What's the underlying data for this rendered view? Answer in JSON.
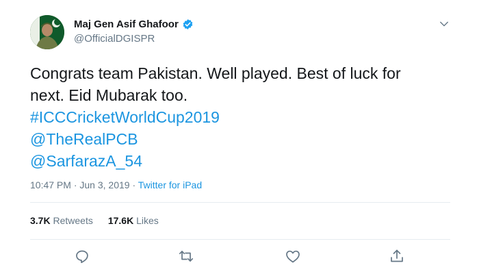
{
  "author": {
    "display_name": "Maj Gen Asif Ghafoor",
    "handle": "@OfficialDGISPR",
    "verified": true
  },
  "tweet": {
    "text_line1": "Congrats team Pakistan. Well played. Best of luck for",
    "text_line2": "next. Eid Mubarak too.",
    "hashtag": "#ICCCricketWorldCup2019",
    "mention1": "@TheRealPCB",
    "mention2": "@SarfarazA_54",
    "time": "10:47 PM",
    "separator1": " · ",
    "date": "Jun 3, 2019",
    "separator2": " · ",
    "source": "Twitter for iPad"
  },
  "stats": {
    "retweets_count": "3.7K",
    "retweets_label": "Retweets",
    "likes_count": "17.6K",
    "likes_label": "Likes"
  },
  "icons": {
    "menu": "chevron-down-icon",
    "reply": "reply-icon",
    "retweet": "retweet-icon",
    "like": "heart-icon",
    "share": "share-icon",
    "verified": "verified-badge-icon"
  },
  "colors": {
    "link": "#1b95e0",
    "secondary_text": "#657786",
    "verified_badge": "#1da1f2"
  }
}
